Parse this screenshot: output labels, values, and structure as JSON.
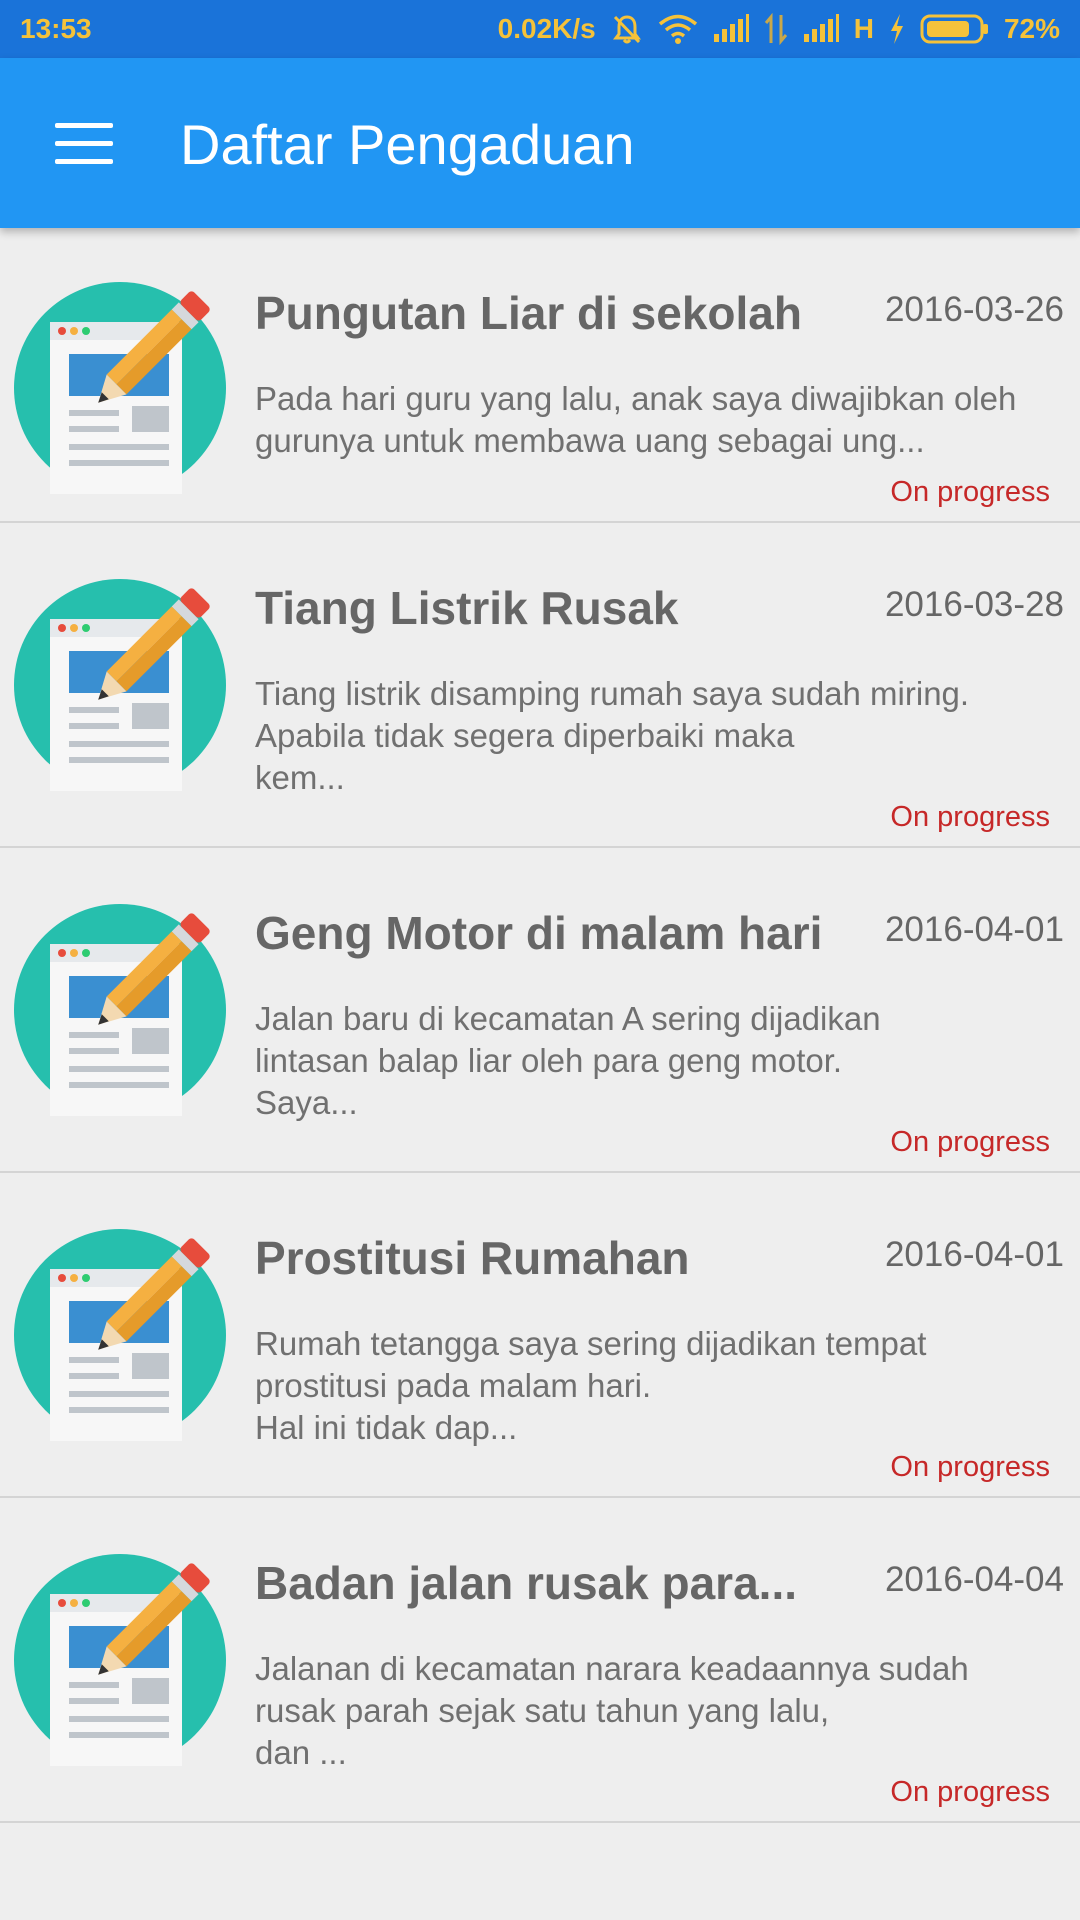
{
  "status_bar": {
    "time": "13:53",
    "net_speed": "0.02K/s",
    "network_type": "H",
    "battery": "72%",
    "icons": [
      "bell-muted-icon",
      "wifi-icon",
      "signal-icon",
      "data-arrows-icon",
      "signal-icon",
      "charging-icon",
      "battery-icon"
    ],
    "color": "#f5c23a"
  },
  "app_bar": {
    "title": "Daftar Pengaduan",
    "menu_icon": "hamburger-menu-icon",
    "color": "#2196f3"
  },
  "complaints": [
    {
      "title": "Pungutan Liar di sekolah",
      "date": "2016-03-26",
      "description": "Pada hari guru yang lalu, anak saya diwajibkan oleh gurunya untuk membawa uang sebagai ung...",
      "status": "On progress"
    },
    {
      "title": "Tiang Listrik Rusak",
      "date": "2016-03-28",
      "description": "Tiang listrik disamping rumah saya sudah miring.\nApabila tidak segera diperbaiki maka\nkem...",
      "status": "On progress"
    },
    {
      "title": "Geng Motor di malam hari",
      "date": "2016-04-01",
      "description": "Jalan baru di kecamatan A sering dijadikan\nlintasan balap liar oleh para geng motor.\nSaya...",
      "status": "On progress"
    },
    {
      "title": "Prostitusi Rumahan",
      "date": "2016-04-01",
      "description": "Rumah tetangga saya sering dijadikan tempat\nprostitusi pada malam hari.\nHal ini tidak dap...",
      "status": "On progress"
    },
    {
      "title": "Badan jalan rusak para...",
      "date": "2016-04-04",
      "description": "Jalanan di kecamatan narara keadaannya sudah\nrusak parah sejak satu tahun yang lalu,\ndan ...",
      "status": "On progress"
    }
  ],
  "colors": {
    "status_text": "#c62828",
    "thumb_circle": "#26bfad",
    "list_background": "#eeeeee"
  }
}
